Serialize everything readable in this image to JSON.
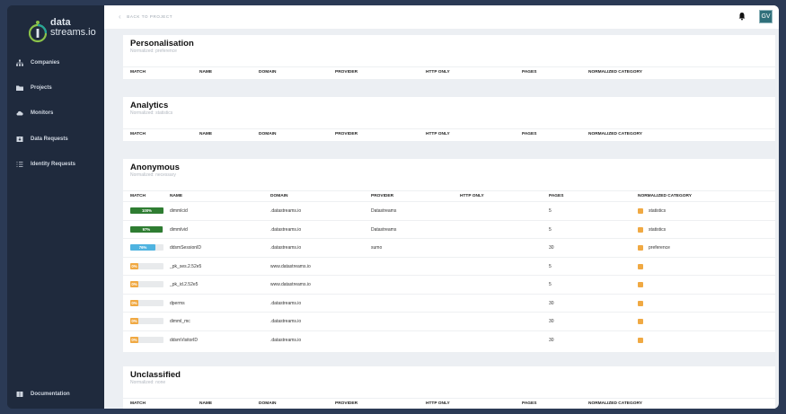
{
  "logo": {
    "line1": "data",
    "line2": "streams.io"
  },
  "sidebar": {
    "items": [
      {
        "label": "Companies",
        "icon": "sitemap-icon"
      },
      {
        "label": "Projects",
        "icon": "folder-icon"
      },
      {
        "label": "Monitors",
        "icon": "cloud-icon"
      },
      {
        "label": "Data Requests",
        "icon": "inbox-icon"
      },
      {
        "label": "Identity Requests",
        "icon": "list-icon"
      }
    ],
    "footer": {
      "label": "Documentation",
      "icon": "book-icon"
    }
  },
  "topbar": {
    "back_label": "BACK TO PROJECT",
    "avatar_initials": "GV"
  },
  "colors": {
    "green": "#2f7d32",
    "blue": "#4fb3e0",
    "orange": "#f0a943",
    "sidebar": "#1f2a3d"
  },
  "headers_short": [
    "MATCH",
    "NAME",
    "DOMAIN",
    "PROVIDER",
    "HTTP ONLY",
    "PAGES",
    "NORMALIZED CATEGORY"
  ],
  "sections": {
    "personalisation": {
      "title": "Personalisation",
      "subtitle": "Normalized: preference"
    },
    "analytics": {
      "title": "Analytics",
      "subtitle": "Normalized: statistics"
    },
    "anonymous": {
      "title": "Anonymous",
      "subtitle": "Normalized: necessary",
      "rows": [
        {
          "match": "100%",
          "match_value": 100,
          "name": "dimmlcid",
          "domain": ".datastreams.io",
          "provider": "Datastreams",
          "pages": "5",
          "category": "statistics"
        },
        {
          "match": "97%",
          "match_value": 97,
          "name": "dimmlvid",
          "domain": ".datastreams.io",
          "provider": "Datastreams",
          "pages": "5",
          "category": "statistics"
        },
        {
          "match": "76%",
          "match_value": 76,
          "name": "ddsmSessionID",
          "domain": ".datastreams.io",
          "provider": "sumo",
          "pages": "30",
          "category": "preference"
        },
        {
          "match": "0%",
          "match_value": 0,
          "name": "_pk_ses.2.52e5",
          "domain": "www.datastreams.io",
          "provider": "",
          "pages": "5",
          "category": ""
        },
        {
          "match": "0%",
          "match_value": 0,
          "name": "_pk_id.2.52e5",
          "domain": "www.datastreams.io",
          "provider": "",
          "pages": "5",
          "category": ""
        },
        {
          "match": "0%",
          "match_value": 0,
          "name": "dperms",
          "domain": ".datastreams.io",
          "provider": "",
          "pages": "30",
          "category": ""
        },
        {
          "match": "0%",
          "match_value": 0,
          "name": "dimml_mc",
          "domain": ".datastreams.io",
          "provider": "",
          "pages": "30",
          "category": ""
        },
        {
          "match": "0%",
          "match_value": 0,
          "name": "ddsmVisitorID",
          "domain": ".datastreams.io",
          "provider": "",
          "pages": "30",
          "category": ""
        }
      ]
    },
    "unclassified": {
      "title": "Unclassified",
      "subtitle": "Normalized: none"
    }
  }
}
